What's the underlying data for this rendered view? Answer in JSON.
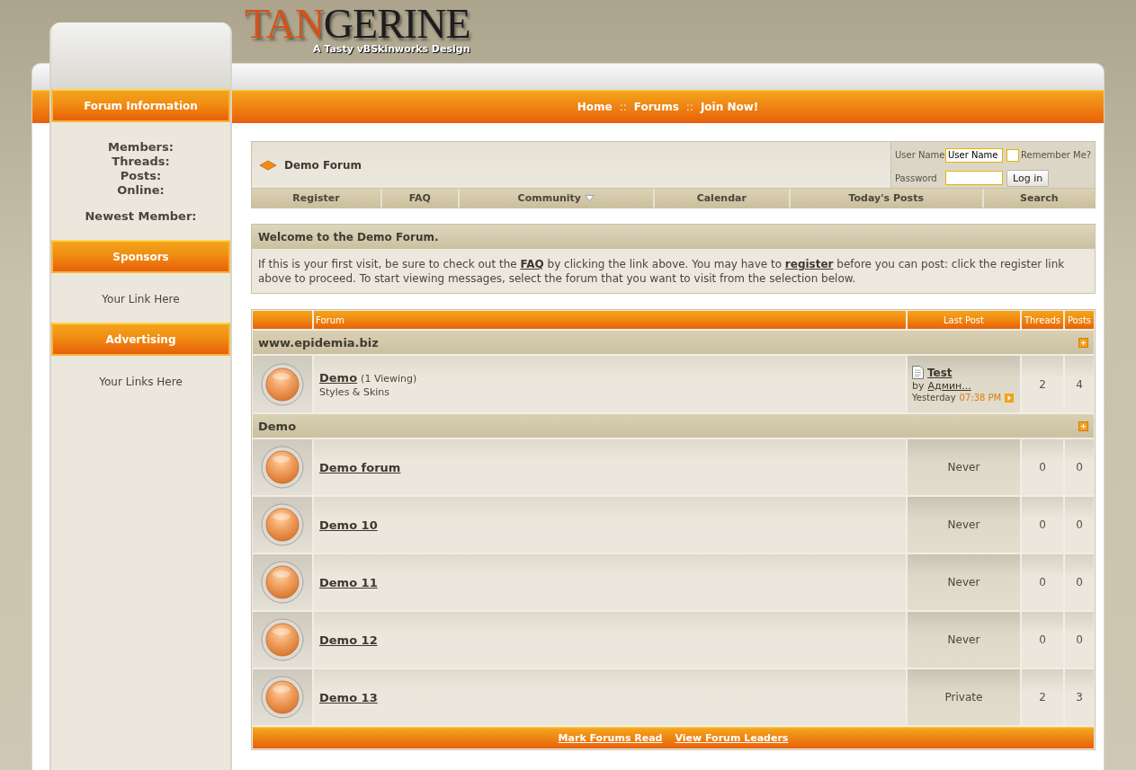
{
  "logo": {
    "accent": "TAN",
    "rest": "GERINE",
    "tagline": "A Tasty vBSkinworks Design"
  },
  "sidebar": [
    {
      "title": "Forum Information",
      "kind": "stats",
      "lines": [
        "Members:",
        "Threads:",
        "Posts:",
        "Online:"
      ],
      "extra": "Newest Member:"
    },
    {
      "title": "Sponsors",
      "kind": "text",
      "text": "Your Link Here"
    },
    {
      "title": "Advertising",
      "kind": "text",
      "text": "Your Links Here"
    }
  ],
  "top_nav": [
    {
      "kind": "link",
      "text": "Home"
    },
    {
      "kind": "separator",
      "text": "::"
    },
    {
      "kind": "link",
      "text": "Forums"
    },
    {
      "kind": "separator",
      "text": "::"
    },
    {
      "kind": "link",
      "text": "Join Now!"
    }
  ],
  "breadcrumb": "Demo Forum",
  "login": {
    "user_label": "User Name",
    "user_value": "User Name",
    "remember_label": "Remember Me?",
    "remember": false,
    "password_label": "Password",
    "button": "Log in"
  },
  "tabs": [
    {
      "label": "Register",
      "dropdown": false
    },
    {
      "label": "FAQ",
      "dropdown": false
    },
    {
      "label": "Community",
      "dropdown": true
    },
    {
      "label": "Calendar",
      "dropdown": false
    },
    {
      "label": "Today's Posts",
      "dropdown": false
    },
    {
      "label": "Search",
      "dropdown": false
    }
  ],
  "welcome": {
    "title": "Welcome to the Demo Forum.",
    "body": [
      {
        "kind": "text",
        "text": "If this is your first visit, be sure to check out the "
      },
      {
        "kind": "link",
        "text": "FAQ"
      },
      {
        "kind": "text",
        "text": " by clicking the link above. You may have to "
      },
      {
        "kind": "link",
        "text": "register"
      },
      {
        "kind": "text",
        "text": " before you can post: click the register link above to proceed. To start viewing messages, select the forum that you want to visit from the selection below."
      }
    ]
  },
  "forum_table": {
    "columns": [
      "Forum",
      "Last Post",
      "Threads",
      "Posts"
    ],
    "categories": [
      {
        "title": "www.epidemia.biz",
        "forums": [
          {
            "name": "Demo",
            "viewing": "(1 Viewing)",
            "description": "Styles & Skins",
            "last_post": {
              "kind": "post",
              "title": "Test",
              "by": "by",
              "author": "Админ...",
              "date": "Yesterday",
              "time": "07:38 PM"
            },
            "threads": "2",
            "posts": "4"
          }
        ]
      },
      {
        "title": "Demo",
        "forums": [
          {
            "name": "Demo forum",
            "last_post": {
              "kind": "text",
              "text": "Never"
            },
            "threads": "0",
            "posts": "0"
          },
          {
            "name": "Demo 10",
            "last_post": {
              "kind": "text",
              "text": "Never"
            },
            "threads": "0",
            "posts": "0"
          },
          {
            "name": "Demo 11",
            "last_post": {
              "kind": "text",
              "text": "Never"
            },
            "threads": "0",
            "posts": "0"
          },
          {
            "name": "Demo 12",
            "last_post": {
              "kind": "text",
              "text": "Never"
            },
            "threads": "0",
            "posts": "0"
          },
          {
            "name": "Demo 13",
            "last_post": {
              "kind": "text",
              "text": "Private"
            },
            "threads": "2",
            "posts": "3"
          }
        ]
      }
    ],
    "footer_links": [
      "Mark Forums Read",
      "View Forum Leaders"
    ]
  }
}
